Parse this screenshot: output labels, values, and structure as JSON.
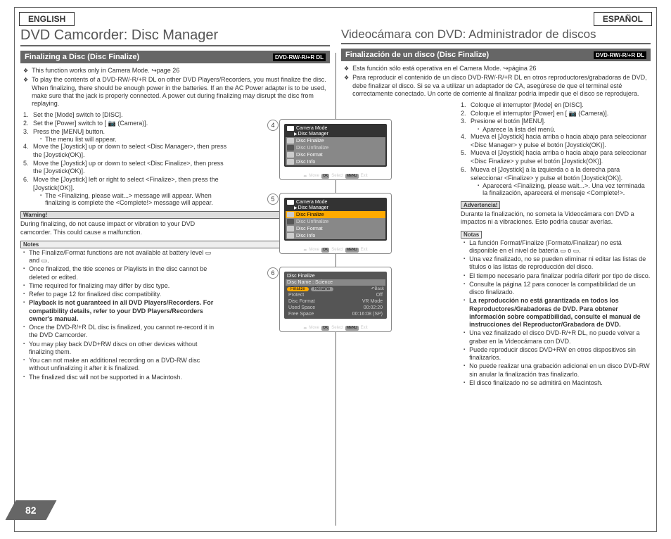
{
  "lang": {
    "left": "ENGLISH",
    "right": "ESPAÑOL"
  },
  "en": {
    "title": "DVD Camcorder: Disc Manager",
    "subtitle": "Finalizing a Disc (Disc Finalize)",
    "disctype": "DVD-RW/-R/+R DL",
    "diamonds": [
      "This function works only in Camera Mode. ↪page 26",
      "To play the contents of a DVD-RW/-R/+R DL on other DVD Players/Recorders, you must finalize the disc. When finalizing, there should be enough power in the batteries. If an the AC Power adapter is to be used, make sure that the jack is properly connected. A power cut during finalizing may disrupt the disc from replaying."
    ],
    "steps": [
      "Set the [Mode] switch to [DISC].",
      "Set the [Power] switch to [ 📷 (Camera)].",
      "Press the [MENU] button.",
      "Move the [Joystick] up or down to select <Disc Manager>, then press the [Joystick(OK)].",
      "Move the [Joystick] up or down to select <Disc Finalize>, then press the [Joystick(OK)].",
      "Move the [Joystick] left or right to select <Finalize>, then press the [Joystick(OK)]."
    ],
    "step3sub": "The menu list will appear.",
    "step6sub": "The <Finalizing, please wait...> message will appear. When finalizing is complete the <Complete!> message will appear.",
    "warn_label": "Warning!",
    "warn_text": "During finalizing, do not cause impact or vibration to your DVD camcorder. This could cause a malfunction.",
    "notes_label": "Notes",
    "notes": [
      "The Finalize/Format functions are not available at battery level ▭ and ▭.",
      "Once finalized, the title scenes or Playlists in the disc cannot be deleted or edited.",
      "Time required for finalizing may differ by disc type.",
      "Refer to page 12 for finalized disc compatibility.",
      "Playback is not guaranteed in all DVD Players/Recorders. For compatibility details, refer to your DVD Players/Recorders owner's manual.",
      "Once the DVD-R/+R DL disc is finalized, you cannot re-record it in the DVD Camcorder.",
      "You may play back DVD+RW discs on other devices without finalizing them.",
      "You can not make an additional recording on a DVD-RW disc without unfinalizing it after it is finalized.",
      "The finalized disc will not be supported in a Macintosh."
    ]
  },
  "es": {
    "title": "Videocámara con DVD: Administrador de discos",
    "subtitle": "Finalización de un disco (Disc Finalize)",
    "disctype": "DVD-RW/-R/+R DL",
    "diamonds": [
      "Esta función sólo está operativa en el Camera Mode. ↪página 26",
      "Para reproducir el contenido de un disco DVD-RW/-R/+R DL en otros reproductores/grabadoras de DVD, debe finalizar el disco. Si se va a utilizar un adaptador de CA, asegúrese de que el terminal esté correctamente conectado. Un corte de corriente al finalizar podría impedir que el disco se reprodujera."
    ],
    "steps": [
      "Coloque el interruptor [Mode] en [DISC].",
      "Coloque el interruptor [Power] en [ 📷 (Camera)].",
      "Presione el botón [MENU].",
      "Mueva el [Joystick] hacia arriba o hacia abajo para seleccionar <Disc Manager> y pulse el botón [Joystick(OK)].",
      "Mueva el [Joystick] hacia arriba o hacia abajo para seleccionar <Disc Finalize> y pulse el botón [Joystick(OK)].",
      "Mueva el [Joystick] a la izquierda o a la derecha para seleccionar <Finalize> y pulse el botón [Joystick(OK)]."
    ],
    "step3sub": "Aparece la lista del menú.",
    "step6sub": "Aparecerá <Finalizing, please wait...>. Una vez terminada la finalización, aparecerá el mensaje <Complete!>.",
    "warn_label": "Advertencia!",
    "warn_text": "Durante la finalización, no someta la Videocámara con DVD a impactos ni a vibraciones. Esto podría causar averías.",
    "notes_label": "Notas",
    "notes": [
      "La función Format/Finalize (Formato/Finalizar) no está disponible en el nivel de batería ▭ o ▭.",
      "Una vez finalizado, no se pueden eliminar ni editar las listas de títulos o las listas de reproducción del disco.",
      "El tiempo necesario para finalizar podría diferir por tipo de disco.",
      "Consulte la página 12 para conocer la compatibilidad de un disco finalizado.",
      "La reproducción no está garantizada en todos los Reproductores/Grabadoras de DVD. Para obtener información sobre compatibilidad, consulte el manual de instrucciones del Reproductor/Grabadora de DVD.",
      "Una vez finalizado el disco DVD-R/+R DL, no puede volver a grabar en la Videocámara con DVD.",
      "Puede reproducir discos DVD+RW en otros dispositivos sin finalizarlos.",
      "No puede realizar una grabación adicional en un disco DVD-RW sin anular la finalización tras finalizarlo.",
      "El disco finalizado no se admitirá en Macintosh."
    ]
  },
  "osd": {
    "camera_mode": "Camera Mode",
    "disc_manager": "Disc Manager",
    "items": [
      "Disc Finalize",
      "Disc Unfinalize",
      "Disc Format",
      "Disc Info"
    ],
    "move": "Move",
    "select": "Select",
    "exit": "Exit",
    "ok": "OK",
    "menu": "MENU",
    "finalize_head": "Disc Finalize",
    "disc_name": "Disc Name : Science",
    "finalize": "Finalize",
    "rename": "Rename",
    "back": "↶Back",
    "rows": [
      [
        "Protect",
        "Off"
      ],
      [
        "Disc Format",
        "VR Mode"
      ],
      [
        "Used Space",
        "00:02:20"
      ],
      [
        "Free Space",
        "00:16:08 (SP)"
      ]
    ]
  },
  "circles": [
    "4",
    "5",
    "6"
  ],
  "page_num": "82"
}
